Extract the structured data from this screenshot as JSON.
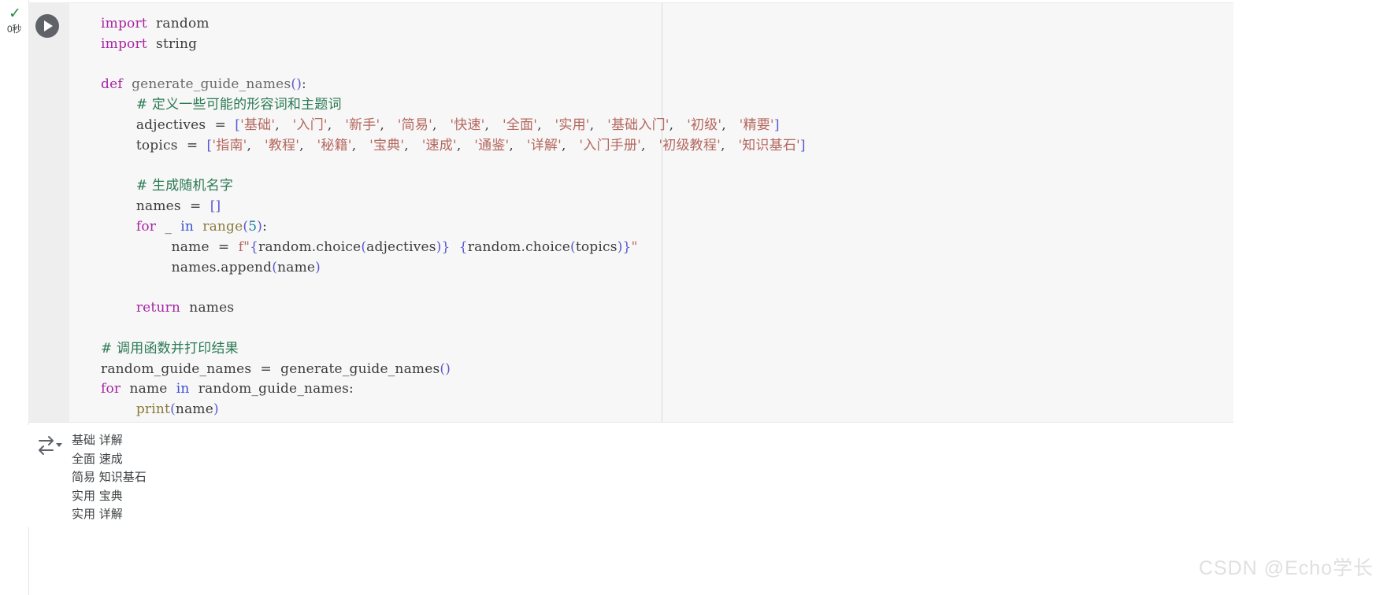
{
  "cell": {
    "status_icon": "check-icon",
    "status_check_glyph": "✓",
    "exec_time": "0秒",
    "run_button_label": "run-cell"
  },
  "code": {
    "language": "python",
    "lines": [
      "import random",
      "import string",
      "",
      "def generate_guide_names():",
      "    # 定义一些可能的形容词和主题词",
      "    adjectives = ['基础', '入门', '新手', '简易', '快速', '全面', '实用', '基础入门', '初级', '精要']",
      "    topics = ['指南', '教程', '秘籍', '宝典', '速成', '通鉴', '详解', '入门手册', '初级教程', '知识基石']",
      "",
      "    # 生成随机名字",
      "    names = []",
      "    for _ in range(5):",
      "        name = f\"{random.choice(adjectives)} {random.choice(topics)}\"",
      "        names.append(name)",
      "",
      "    return names",
      "",
      "# 调用函数并打印结果",
      "random_guide_names = generate_guide_names()",
      "for name in random_guide_names:",
      "    print(name)"
    ],
    "adjectives": [
      "基础",
      "入门",
      "新手",
      "简易",
      "快速",
      "全面",
      "实用",
      "基础入门",
      "初级",
      "精要"
    ],
    "topics": [
      "指南",
      "教程",
      "秘籍",
      "宝典",
      "速成",
      "通鉴",
      "详解",
      "入门手册",
      "初级教程",
      "知识基石"
    ],
    "comments": {
      "define": "定义一些可能的形容词和主题词",
      "generate": "生成随机名字",
      "call": "调用函数并打印结果"
    },
    "loop_count": 5
  },
  "output": {
    "icon": "output-arrow-icon",
    "lines": [
      "基础 详解",
      "全面 速成",
      "简易 知识基石",
      "实用 宝典",
      "实用 详解"
    ],
    "text": "基础 详解\n全面 速成\n简易 知识基石\n实用 宝典\n实用 详解"
  },
  "watermark": {
    "text": "CSDN @Echo学长"
  },
  "colors": {
    "cell_bg": "#f7f7f7",
    "gutter_bg": "#eeeeee",
    "keyword": "#a626a4",
    "string": "#b5685f",
    "comment": "#2b7a55",
    "number": "#1c7fa3",
    "bracket": "#5a5ad0",
    "status_ok": "#1e8e3e"
  }
}
